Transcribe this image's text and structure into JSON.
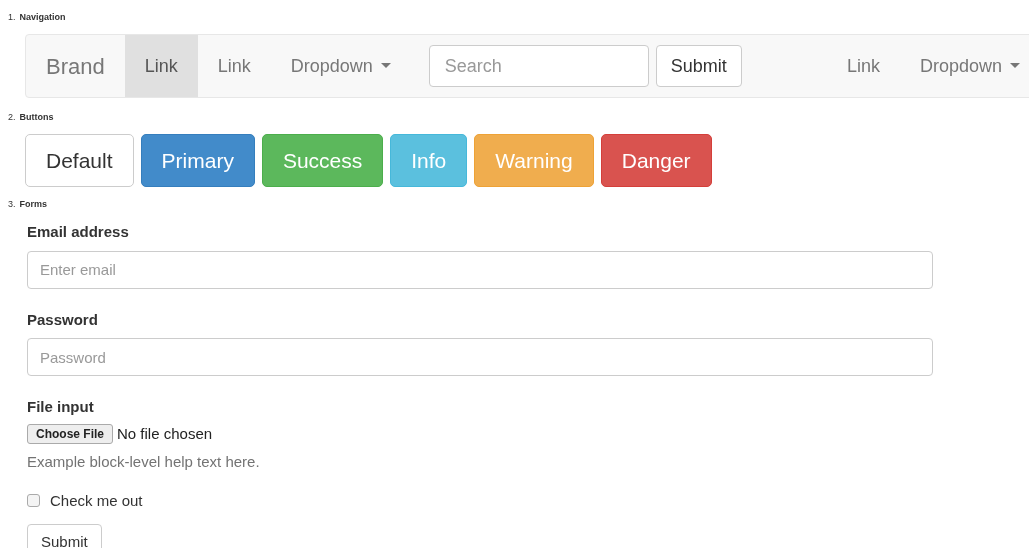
{
  "sections": [
    {
      "number": "1.",
      "title": "Navigation",
      "kind": "navbar"
    },
    {
      "number": "2.",
      "title": "Buttons",
      "kind": "buttons"
    },
    {
      "number": "3.",
      "title": "Forms",
      "kind": "forms"
    }
  ],
  "navbar": {
    "brand": "Brand",
    "left_items": [
      {
        "label": "Link",
        "selected": true,
        "kind": "link"
      },
      {
        "label": "Link",
        "selected": false,
        "kind": "link"
      },
      {
        "label": "Dropdown",
        "selected": false,
        "kind": "dropdown"
      }
    ],
    "search": {
      "placeholder": "Search"
    },
    "submit": "Submit",
    "right_items": [
      {
        "label": "Link",
        "selected": false,
        "kind": "link"
      },
      {
        "label": "Dropdown",
        "selected": false,
        "kind": "dropdown"
      }
    ]
  },
  "buttons": [
    {
      "label": "Default",
      "kind": "default"
    },
    {
      "label": "Primary",
      "kind": "primary"
    },
    {
      "label": "Success",
      "kind": "success"
    },
    {
      "label": "Info",
      "kind": "info"
    },
    {
      "label": "Warning",
      "kind": "warning"
    },
    {
      "label": "Danger",
      "kind": "danger"
    }
  ],
  "form": {
    "fields": [
      {
        "label": "Email address",
        "placeholder": "Enter email"
      },
      {
        "label": "Password",
        "placeholder": "Password"
      }
    ],
    "file": {
      "label": "File input",
      "button": "Choose File",
      "status": "No file chosen",
      "help": "Example block-level help text here."
    },
    "checkbox": {
      "label": "Check me out",
      "checked": false
    },
    "submit": "Submit"
  }
}
